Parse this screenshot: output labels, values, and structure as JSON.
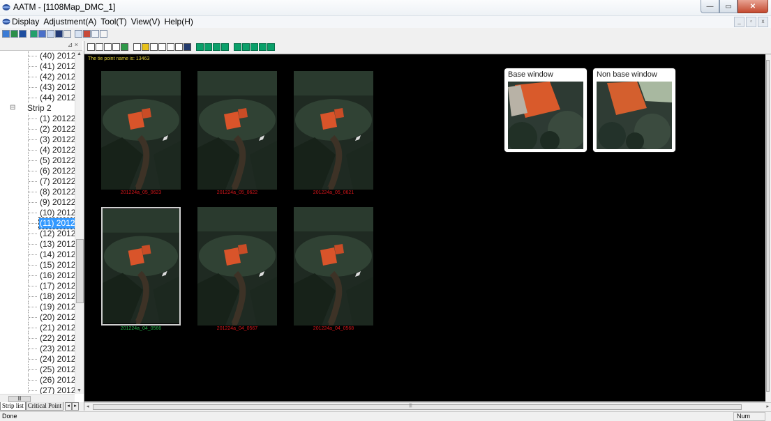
{
  "window": {
    "title": "AATM - [1108Map_DMC_1]",
    "min_glyph": "—",
    "max_glyph": "▭",
    "close_glyph": "✕"
  },
  "menu": {
    "items": [
      "Display",
      "Adjustment(A)",
      "Tool(T)",
      "View(V)",
      "Help(H)"
    ]
  },
  "tree": {
    "items": [
      {
        "label": "(40) 2012",
        "type": "image"
      },
      {
        "label": "(41) 2012",
        "type": "image"
      },
      {
        "label": "(42) 2012",
        "type": "image"
      },
      {
        "label": "(43) 2012",
        "type": "image"
      },
      {
        "label": "(44) 2012",
        "type": "image"
      },
      {
        "label": "Strip 2",
        "type": "strip"
      },
      {
        "label": "(1) 20122",
        "type": "image"
      },
      {
        "label": "(2) 20122",
        "type": "image"
      },
      {
        "label": "(3) 20122",
        "type": "image"
      },
      {
        "label": "(4) 20122",
        "type": "image"
      },
      {
        "label": "(5) 20122",
        "type": "image"
      },
      {
        "label": "(6) 20122",
        "type": "image"
      },
      {
        "label": "(7) 20122",
        "type": "image"
      },
      {
        "label": "(8) 20122",
        "type": "image"
      },
      {
        "label": "(9) 20122",
        "type": "image"
      },
      {
        "label": "(10) 2012",
        "type": "image"
      },
      {
        "label": "(11) 2012",
        "type": "image",
        "selected": true
      },
      {
        "label": "(12) 2012",
        "type": "image"
      },
      {
        "label": "(13) 2012",
        "type": "image"
      },
      {
        "label": "(14) 2012",
        "type": "image"
      },
      {
        "label": "(15) 2012",
        "type": "image"
      },
      {
        "label": "(16) 2012",
        "type": "image"
      },
      {
        "label": "(17) 2012",
        "type": "image"
      },
      {
        "label": "(18) 2012",
        "type": "image"
      },
      {
        "label": "(19) 2012",
        "type": "image"
      },
      {
        "label": "(20) 2012",
        "type": "image"
      },
      {
        "label": "(21) 2012",
        "type": "image"
      },
      {
        "label": "(22) 2012",
        "type": "image"
      },
      {
        "label": "(23) 2012",
        "type": "image"
      },
      {
        "label": "(24) 2012",
        "type": "image"
      },
      {
        "label": "(25) 2012",
        "type": "image"
      },
      {
        "label": "(26) 2012",
        "type": "image"
      },
      {
        "label": "(27) 2012",
        "type": "image"
      }
    ]
  },
  "left_tabs": {
    "strip_list": "Strip list",
    "critical_point": "Critical Point"
  },
  "canvas": {
    "tie_point_label": "The tie point name is: 13463",
    "thumbnails": [
      {
        "caption": "201224a_05_0623",
        "caption_color": "#d8161b",
        "selected": false
      },
      {
        "caption": "201224a_05_0622",
        "caption_color": "#d8161b",
        "selected": false
      },
      {
        "caption": "201224a_05_0621",
        "caption_color": "#d8161b",
        "selected": false
      },
      {
        "caption": "201224a_04_0566",
        "caption_color": "#27b24a",
        "selected": true
      },
      {
        "caption": "201224a_04_0567",
        "caption_color": "#d8161b",
        "selected": false
      },
      {
        "caption": "201224a_04_0568",
        "caption_color": "#d8161b",
        "selected": false
      }
    ],
    "base_window_title": "Base window",
    "non_base_window_title": "Non base window"
  },
  "status": {
    "text": "Done",
    "num": "Num"
  },
  "colors": {
    "selected_bg": "#3399ff",
    "caption_red": "#d8161b",
    "caption_green": "#27b24a",
    "tie_label": "#e5d43a"
  }
}
